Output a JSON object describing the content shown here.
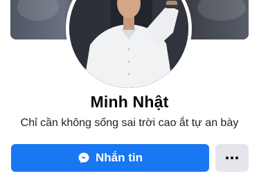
{
  "profile": {
    "name": "Minh Nhật",
    "bio": "Chỉ cần không sống sai trời cao ắt tự an bày"
  },
  "actions": {
    "message_label": "Nhắn tin",
    "message_icon": "messenger-icon",
    "more_icon": "more-dots-icon"
  },
  "colors": {
    "primary": "#1877f2",
    "secondary_button": "#e4e6eb",
    "text": "#050505"
  }
}
